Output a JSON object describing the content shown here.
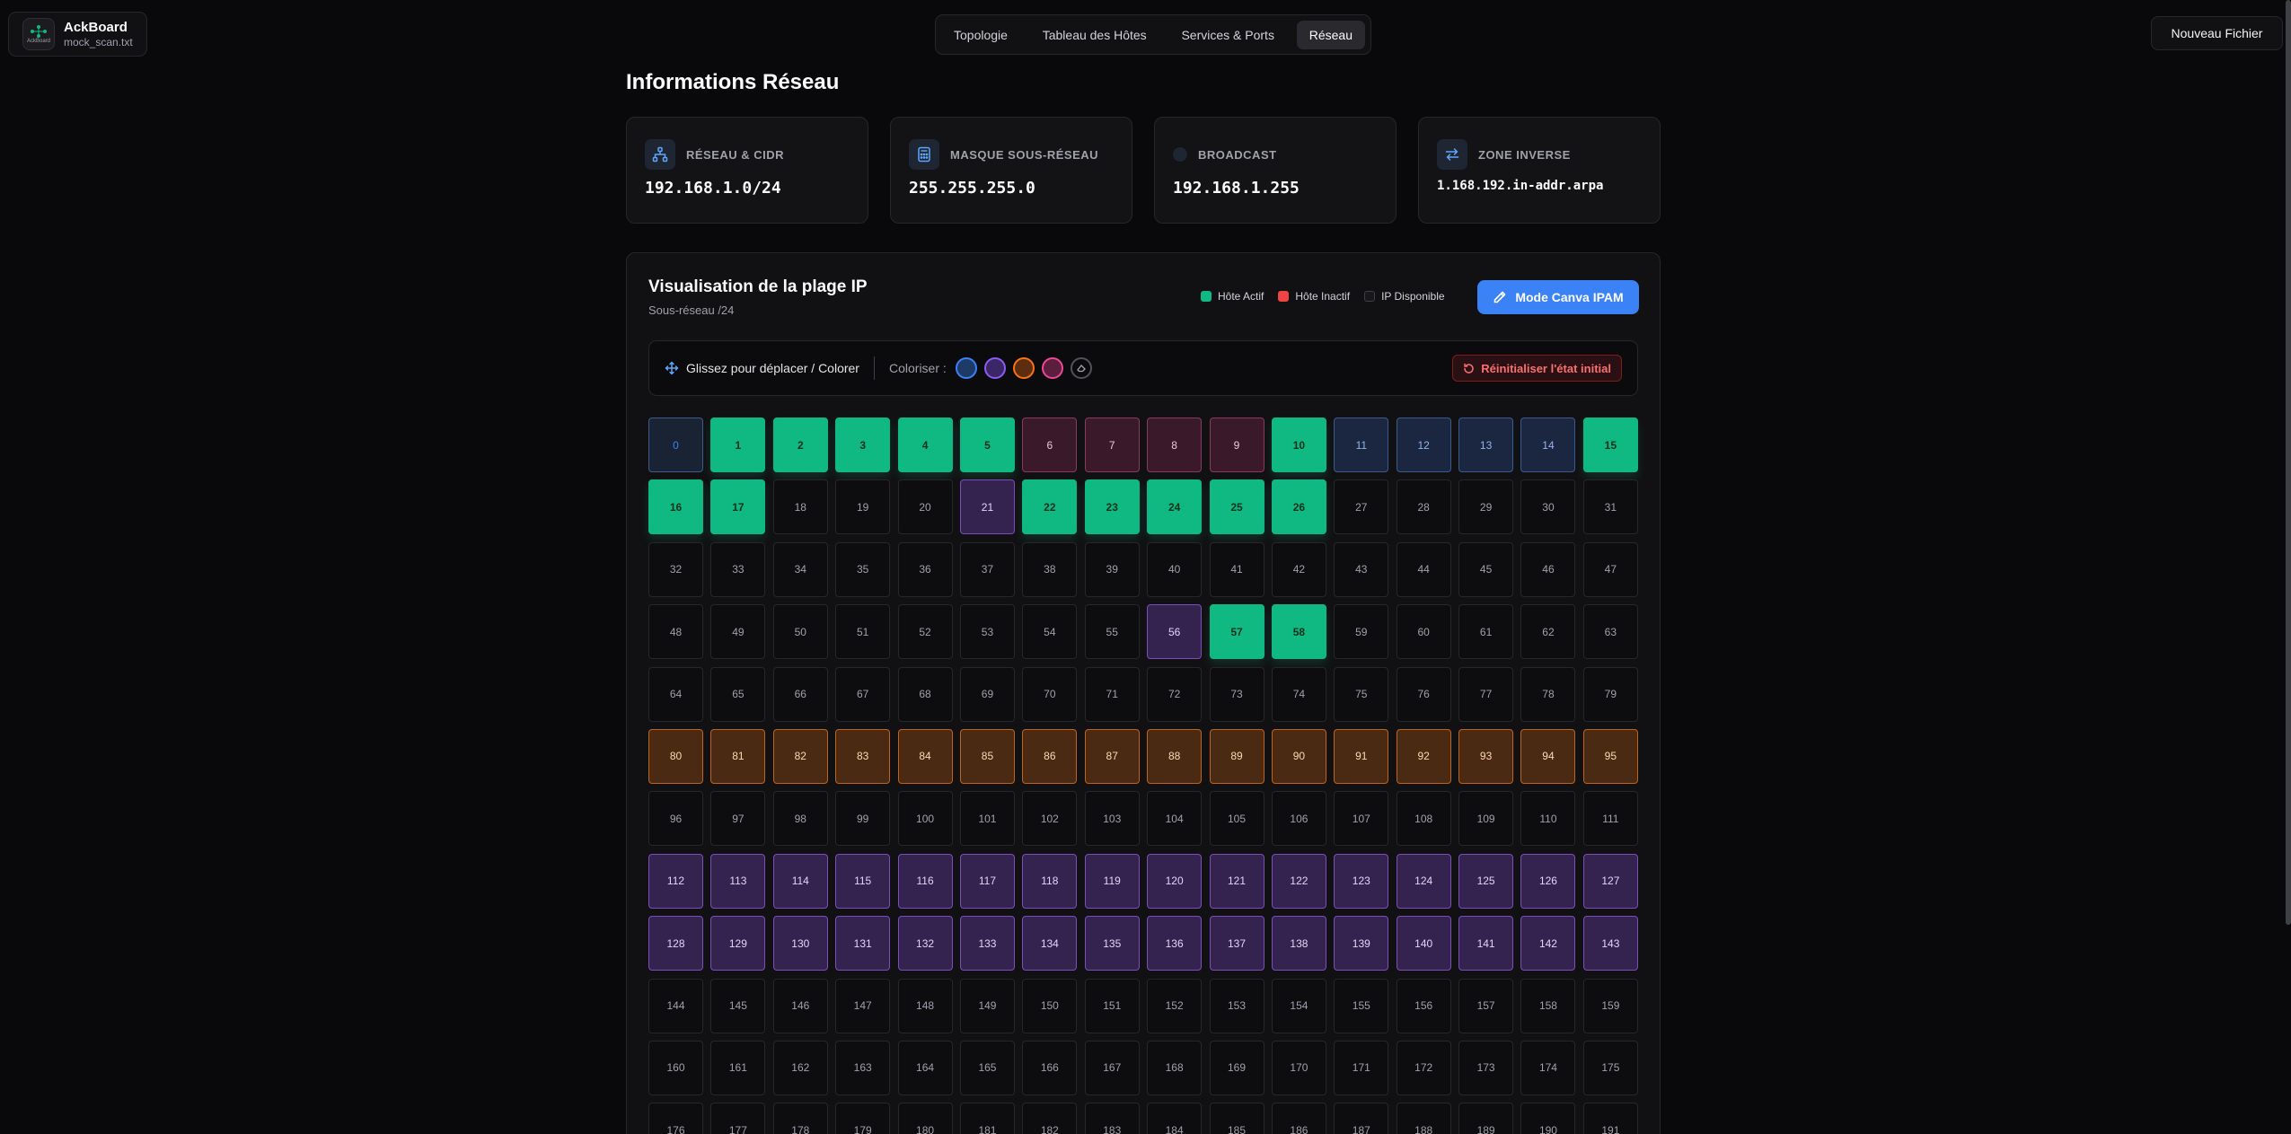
{
  "brand": {
    "name": "AckBoard",
    "file": "mock_scan.txt",
    "logo_text": "AckBoard"
  },
  "nav": {
    "tabs": [
      {
        "label": "Topologie",
        "active": false
      },
      {
        "label": "Tableau des Hôtes",
        "active": false
      },
      {
        "label": "Services & Ports",
        "active": false
      },
      {
        "label": "Réseau",
        "active": true
      }
    ]
  },
  "header": {
    "new_file_label": "Nouveau Fichier"
  },
  "page": {
    "title": "Informations Réseau"
  },
  "cards": [
    {
      "label": "Réseau & CIDR",
      "value": "192.168.1.0/24",
      "icon": "network-icon"
    },
    {
      "label": "Masque Sous-Réseau",
      "value": "255.255.255.0",
      "icon": "calculator-icon"
    },
    {
      "label": "Broadcast",
      "value": "192.168.1.255",
      "icon": "broadcast-dot-icon"
    },
    {
      "label": "Zone Inverse",
      "value": "1.168.192.in-addr.arpa",
      "icon": "swap-arrows-icon"
    }
  ],
  "visualization": {
    "title": "Visualisation de la plage IP",
    "subtitle": "Sous-réseau /24",
    "legend": [
      {
        "label": "Hôte Actif",
        "color": "#10b981"
      },
      {
        "label": "Hôte Inactif",
        "color": "#ef4444"
      },
      {
        "label": "IP Disponible",
        "color": "#18181b"
      }
    ],
    "ipam_button_label": "Mode Canva IPAM",
    "toolbar": {
      "drag_hint": "Glissez pour déplacer / Colorer",
      "colorize_label": "Coloriser :",
      "colors": [
        "#3b82f6",
        "#8b5cf6",
        "#f97316",
        "#ec4899"
      ],
      "reset_label": "Réinitialiser l'état initial"
    },
    "ip_states": {
      "active": [
        1,
        2,
        3,
        4,
        5,
        10,
        15,
        16,
        17,
        22,
        23,
        24,
        25,
        26,
        57,
        58
      ],
      "blue": [
        0,
        11,
        12,
        13,
        14
      ],
      "pink": [
        6,
        7,
        8,
        9
      ],
      "purple": [
        21,
        56,
        112,
        113,
        114,
        115,
        116,
        117,
        118,
        119,
        120,
        121,
        122,
        123,
        124,
        125,
        126,
        127,
        128,
        129,
        130,
        131,
        132,
        133,
        134,
        135,
        136,
        137,
        138,
        139,
        140,
        141,
        142,
        143
      ],
      "orange": [
        80,
        81,
        82,
        83,
        84,
        85,
        86,
        87,
        88,
        89,
        90,
        91,
        92,
        93,
        94,
        95
      ]
    },
    "visible_count": 192
  }
}
